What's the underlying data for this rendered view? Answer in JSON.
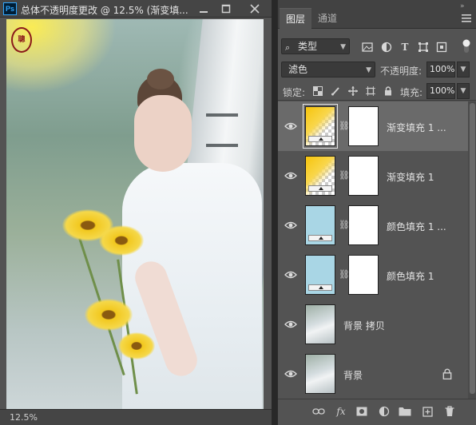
{
  "document": {
    "app_badge": "Ps",
    "title": "总体不透明度更改 @ 12.5% (渐变填...",
    "zoom": "12.5%",
    "canvas_stamp": "聰"
  },
  "window_controls": {
    "minimize_icon": "minimize-icon",
    "maximize_icon": "maximize-icon",
    "close_icon": "close-icon"
  },
  "panel": {
    "tabs": [
      "图层",
      "通道"
    ],
    "active_tab": "图层",
    "filter": {
      "kind_label": "类型",
      "icons": [
        "image-filter-icon",
        "adjustment-filter-icon",
        "type-filter-icon",
        "shape-filter-icon",
        "smart-object-filter-icon"
      ]
    },
    "blend": {
      "mode": "滤色",
      "opacity_label": "不透明度:",
      "opacity_value": "100%"
    },
    "lock": {
      "label": "锁定:",
      "icons": [
        "lock-transparency-icon",
        "lock-pixels-icon",
        "lock-position-icon",
        "lock-artboard-icon",
        "lock-all-icon"
      ],
      "fill_label": "填充:",
      "fill_value": "100%"
    },
    "layers": [
      {
        "name": "渐变填充 1 ...",
        "type": "gradient-fill",
        "selected": true,
        "visible": true,
        "has_mask": true,
        "locked": false
      },
      {
        "name": "渐变填充 1",
        "type": "gradient-fill",
        "selected": false,
        "visible": true,
        "has_mask": true,
        "locked": false
      },
      {
        "name": "颜色填充 1 ...",
        "type": "color-fill",
        "fill_color": "#a9d6e5",
        "selected": false,
        "visible": true,
        "has_mask": true,
        "locked": false
      },
      {
        "name": "颜色填充 1",
        "type": "color-fill",
        "fill_color": "#a9d6e5",
        "selected": false,
        "visible": true,
        "has_mask": true,
        "locked": false
      },
      {
        "name": "背景 拷贝",
        "type": "pixel",
        "selected": false,
        "visible": true,
        "has_mask": false,
        "locked": false
      },
      {
        "name": "背景",
        "type": "pixel",
        "selected": false,
        "visible": true,
        "has_mask": false,
        "locked": true
      }
    ],
    "footer_icons": [
      "link-layers-icon",
      "fx-icon",
      "add-mask-icon",
      "adjustment-layer-icon",
      "new-group-icon",
      "new-layer-icon",
      "delete-layer-icon"
    ],
    "footer_fx_label": "fx"
  },
  "colors": {
    "ps_blue": "#31a8ff",
    "panel_bg": "#535353",
    "selected_row": "#6a6a6a",
    "color_fill": "#a9d6e5"
  }
}
